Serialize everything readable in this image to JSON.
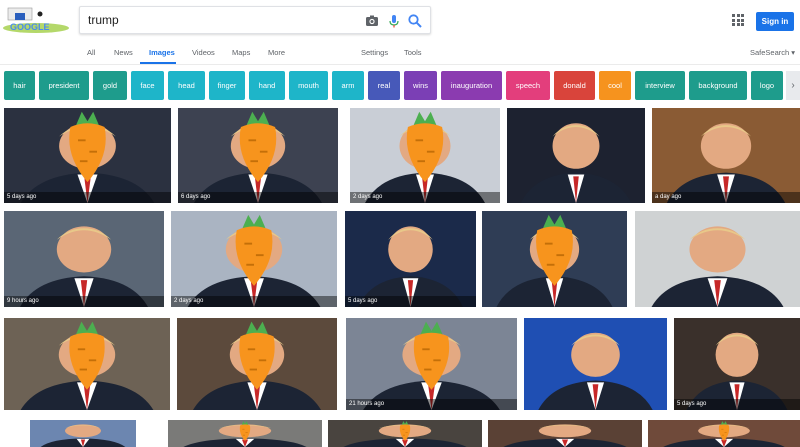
{
  "header": {
    "logo_text": "GOOGLE",
    "search_value": "trump",
    "signin_label": "Sign in"
  },
  "tabs": [
    {
      "label": "All",
      "active": false
    },
    {
      "label": "News",
      "active": false
    },
    {
      "label": "Images",
      "active": true
    },
    {
      "label": "Videos",
      "active": false
    },
    {
      "label": "Maps",
      "active": false
    },
    {
      "label": "More",
      "active": false
    }
  ],
  "tools": {
    "settings": "Settings",
    "tools": "Tools",
    "safesearch": "SafeSearch ▾"
  },
  "chips": [
    {
      "label": "hair",
      "color": "#1e9c8c"
    },
    {
      "label": "president",
      "color": "#1e9c8c"
    },
    {
      "label": "gold",
      "color": "#1e9c8c"
    },
    {
      "label": "face",
      "color": "#1eb5c9"
    },
    {
      "label": "head",
      "color": "#1eb5c9"
    },
    {
      "label": "finger",
      "color": "#1eb5c9"
    },
    {
      "label": "hand",
      "color": "#1eb5c9"
    },
    {
      "label": "mouth",
      "color": "#1eb5c9"
    },
    {
      "label": "arm",
      "color": "#1eb5c9"
    },
    {
      "label": "real",
      "color": "#4759b9"
    },
    {
      "label": "wins",
      "color": "#7b3fb5"
    },
    {
      "label": "inauguration",
      "color": "#8b3bb0"
    },
    {
      "label": "speech",
      "color": "#e33e7c"
    },
    {
      "label": "donald",
      "color": "#d9443b"
    },
    {
      "label": "cool",
      "color": "#f6931e"
    },
    {
      "label": "interview",
      "color": "#1e9c8c"
    },
    {
      "label": "background",
      "color": "#1e9c8c"
    },
    {
      "label": "logo",
      "color": "#1e9c8c"
    }
  ],
  "chip_next_icon": "chevron-right-icon",
  "images": [
    {
      "age": "5 days ago",
      "carrot": true,
      "bg": "#2b3140"
    },
    {
      "age": "6 days ago",
      "carrot": true,
      "bg": "#3d4251"
    },
    {
      "age": "2 days ago",
      "carrot": true,
      "bg": "#c9ced6"
    },
    {
      "age": "",
      "carrot": false,
      "bg": "#1d2230"
    },
    {
      "age": "a day ago",
      "carrot": false,
      "bg": "#8a5b34"
    },
    {
      "age": "9 hours ago",
      "carrot": false,
      "bg": "#5a6675"
    },
    {
      "age": "2 days ago",
      "carrot": true,
      "bg": "#aab4c2"
    },
    {
      "age": "5 days ago",
      "carrot": false,
      "bg": "#1b2a4a"
    },
    {
      "age": "",
      "carrot": true,
      "bg": "#2f3d55"
    },
    {
      "age": "",
      "carrot": false,
      "bg": "#cfd2d3"
    },
    {
      "age": "",
      "carrot": true,
      "bg": "#6d6255"
    },
    {
      "age": "",
      "carrot": true,
      "bg": "#5c4a3c"
    },
    {
      "age": "21 hours ago",
      "carrot": true,
      "bg": "#7c8595"
    },
    {
      "age": "",
      "carrot": false,
      "bg": "#1f4fb3"
    },
    {
      "age": "5 days ago",
      "carrot": false,
      "bg": "#3a302b"
    },
    {
      "age": "",
      "carrot": false,
      "bg": "#6c86b0"
    },
    {
      "age": "",
      "carrot": true,
      "bg": "#7a7a78"
    },
    {
      "age": "",
      "carrot": true,
      "bg": "#49443f"
    },
    {
      "age": "",
      "carrot": false,
      "bg": "#5a4135"
    },
    {
      "age": "",
      "carrot": true,
      "bg": "#6f4a3a"
    }
  ]
}
